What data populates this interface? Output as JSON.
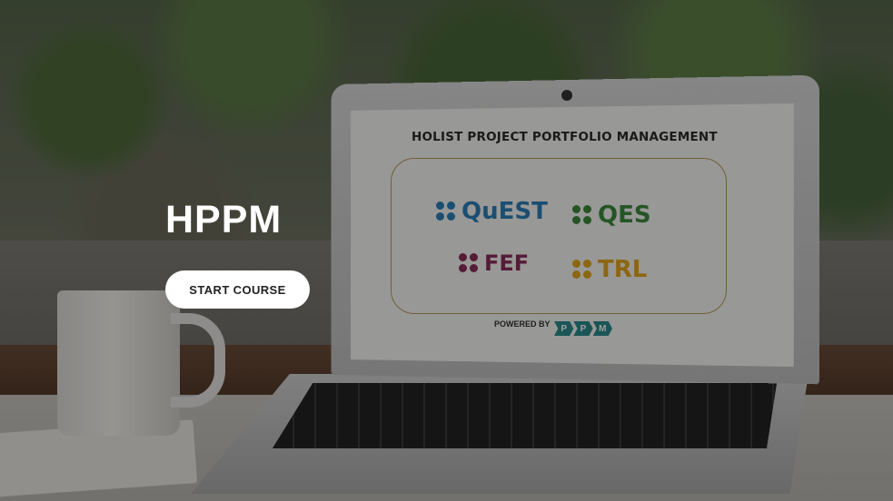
{
  "hero": {
    "title": "HPPM",
    "start_button_label": "START COURSE"
  },
  "laptop_screen": {
    "heading": "HOLIST PROJECT PORTFOLIO MANAGEMENT",
    "products": [
      {
        "name": "QuEST",
        "color": "#2d7fb6"
      },
      {
        "name": "QES",
        "color": "#3c8a3c"
      },
      {
        "name": "FEF",
        "color": "#8a2d5a"
      },
      {
        "name": "TRL",
        "color": "#e2a51c"
      }
    ],
    "powered_by_label": "POWERED BY",
    "powered_by_letters": [
      "P",
      "P",
      "M"
    ],
    "accent_teal": "#2a8b8c",
    "box_border": "#b59b58"
  }
}
